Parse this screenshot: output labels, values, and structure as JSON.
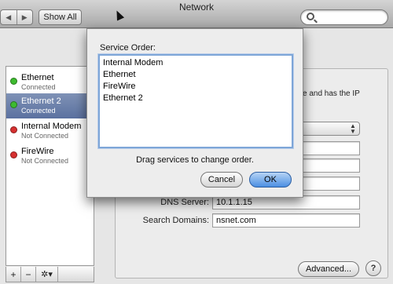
{
  "window": {
    "title": "Network"
  },
  "toolbar": {
    "back": "◀",
    "forward": "▶",
    "show_all": "Show All"
  },
  "sidebar": {
    "services": [
      {
        "name": "Ethernet",
        "status": "Connected",
        "dot_color": "#3dbb2f"
      },
      {
        "name": "Ethernet 2",
        "status": "Connected",
        "dot_color": "#3dbb2f"
      },
      {
        "name": "Internal Modem",
        "status": "Not Connected",
        "dot_color": "#d63030"
      },
      {
        "name": "FireWire",
        "status": "Not Connected",
        "dot_color": "#d63030"
      }
    ],
    "footer": {
      "add": "+",
      "remove": "−",
      "action": "✲▾"
    }
  },
  "pane": {
    "partial_text_1": "e and has the IP",
    "partial_text_2": "",
    "dns_label": "DNS Server:",
    "dns_value": "10.1.1.15",
    "search_label": "Search Domains:",
    "search_value": "nsnet.com",
    "advanced": "Advanced...",
    "help": "?"
  },
  "sheet": {
    "title": "Service Order:",
    "items": [
      "Internal Modem",
      "Ethernet",
      "FireWire",
      "Ethernet 2"
    ],
    "hint": "Drag services to change order.",
    "cancel": "Cancel",
    "ok": "OK"
  }
}
